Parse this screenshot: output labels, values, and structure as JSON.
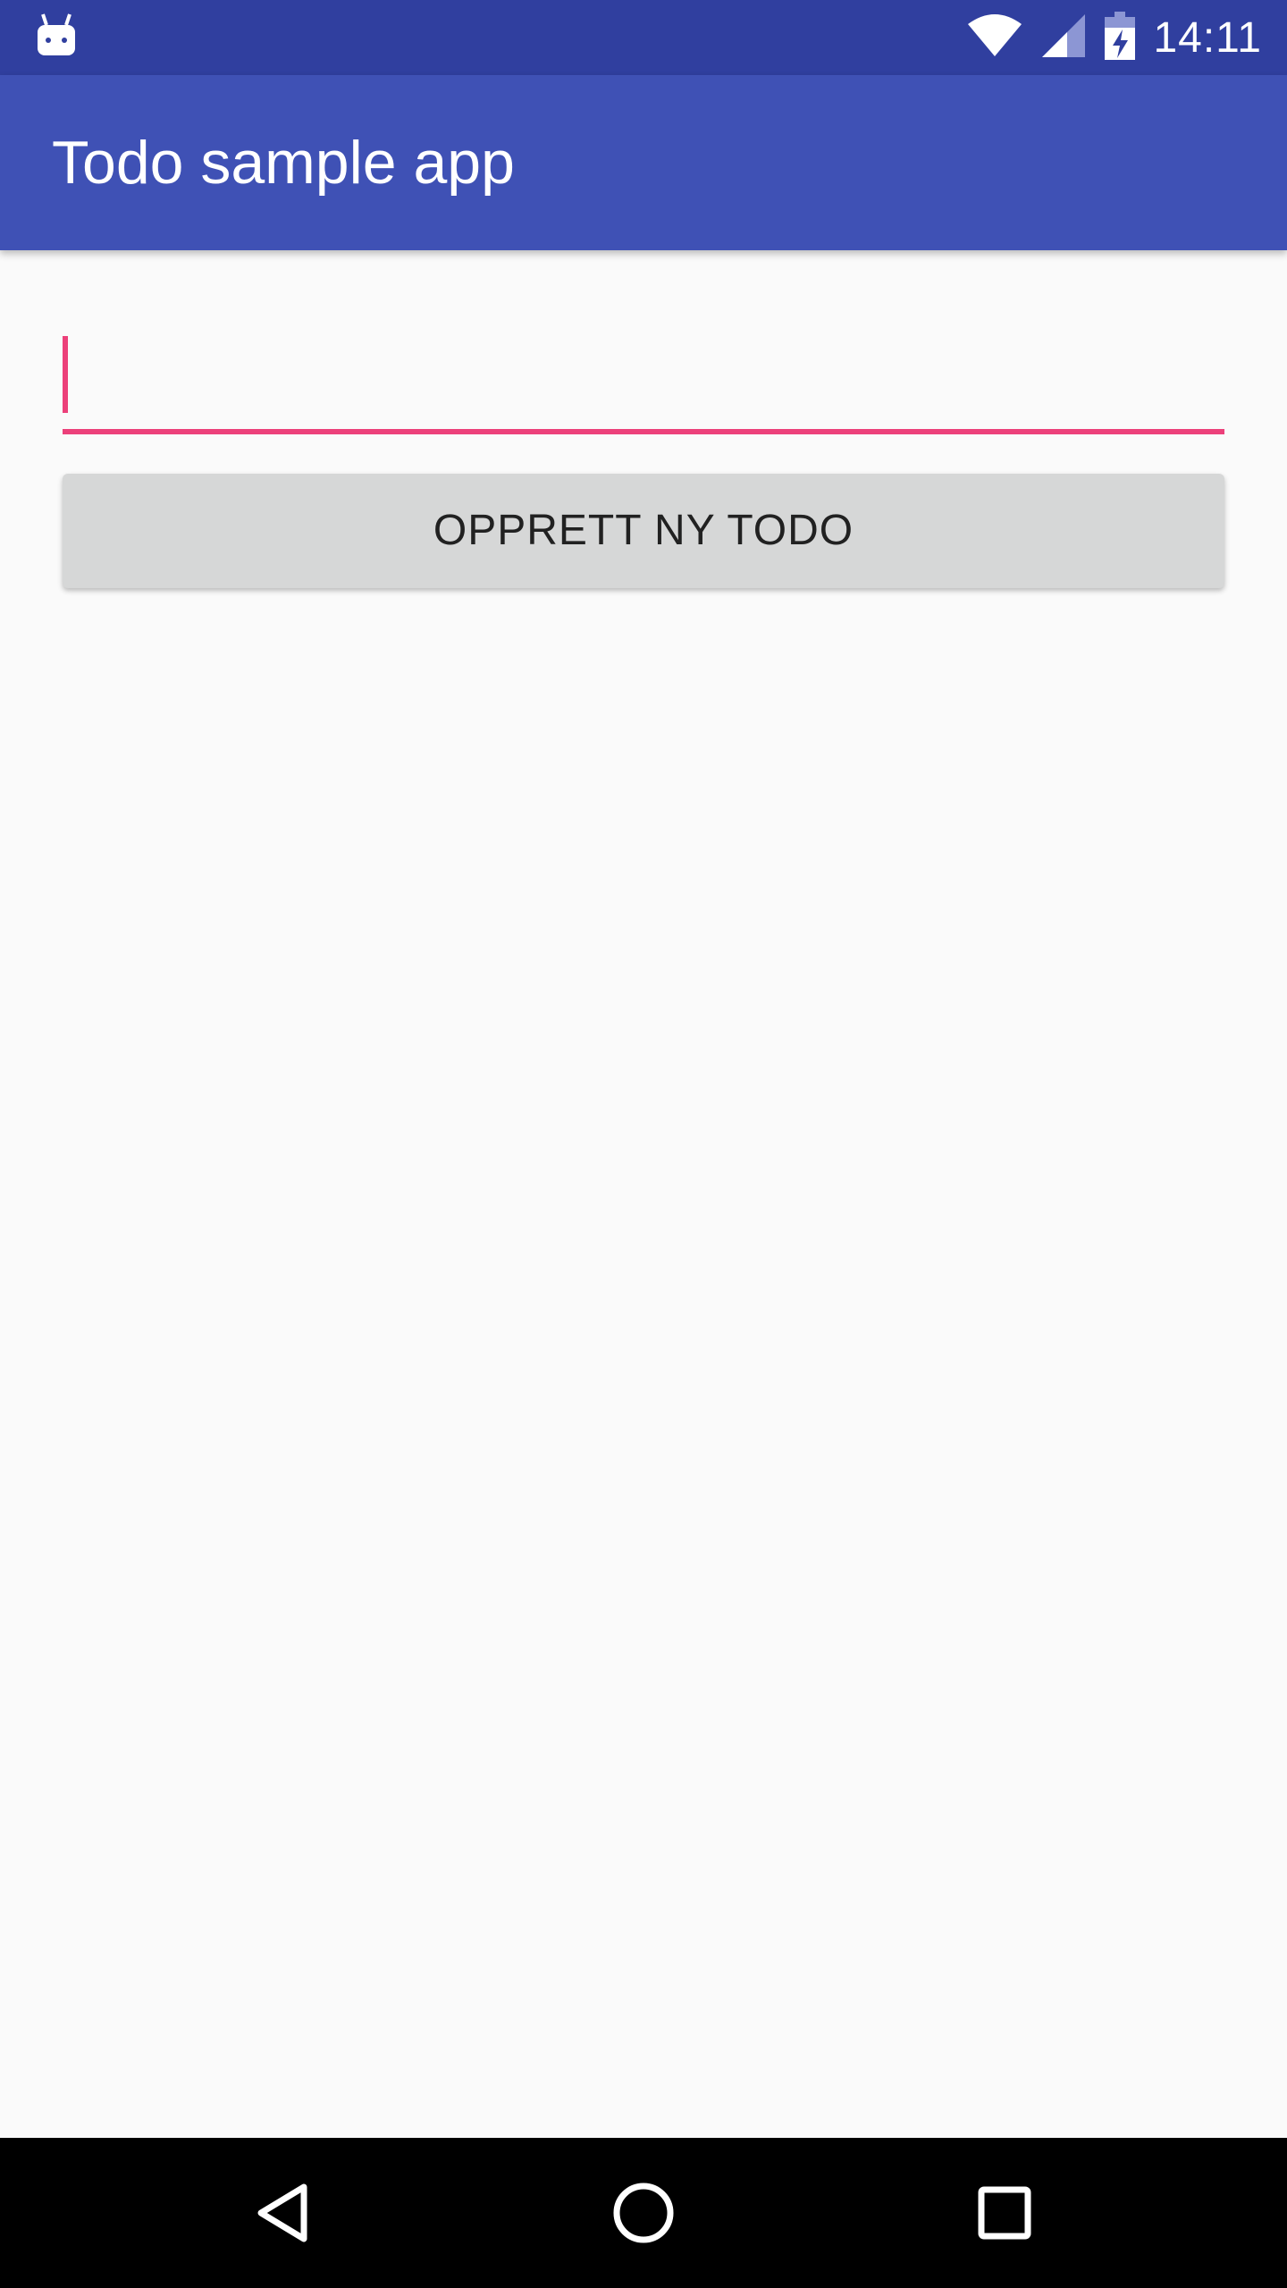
{
  "status_bar": {
    "time": "14:11",
    "icons": [
      "android-debug-icon",
      "wifi-icon",
      "cell-signal-icon",
      "battery-charging-icon"
    ],
    "background_color": "#303f9f"
  },
  "app_bar": {
    "title": "Todo sample app",
    "background_color": "#3f51b5"
  },
  "form": {
    "todo_input": {
      "value": "",
      "placeholder": "",
      "focused": true,
      "accent_color": "#ec407a"
    },
    "create_button_label": "OPPRETT NY TODO"
  },
  "nav_bar": {
    "buttons": [
      "back-icon",
      "home-icon",
      "recents-icon"
    ]
  }
}
